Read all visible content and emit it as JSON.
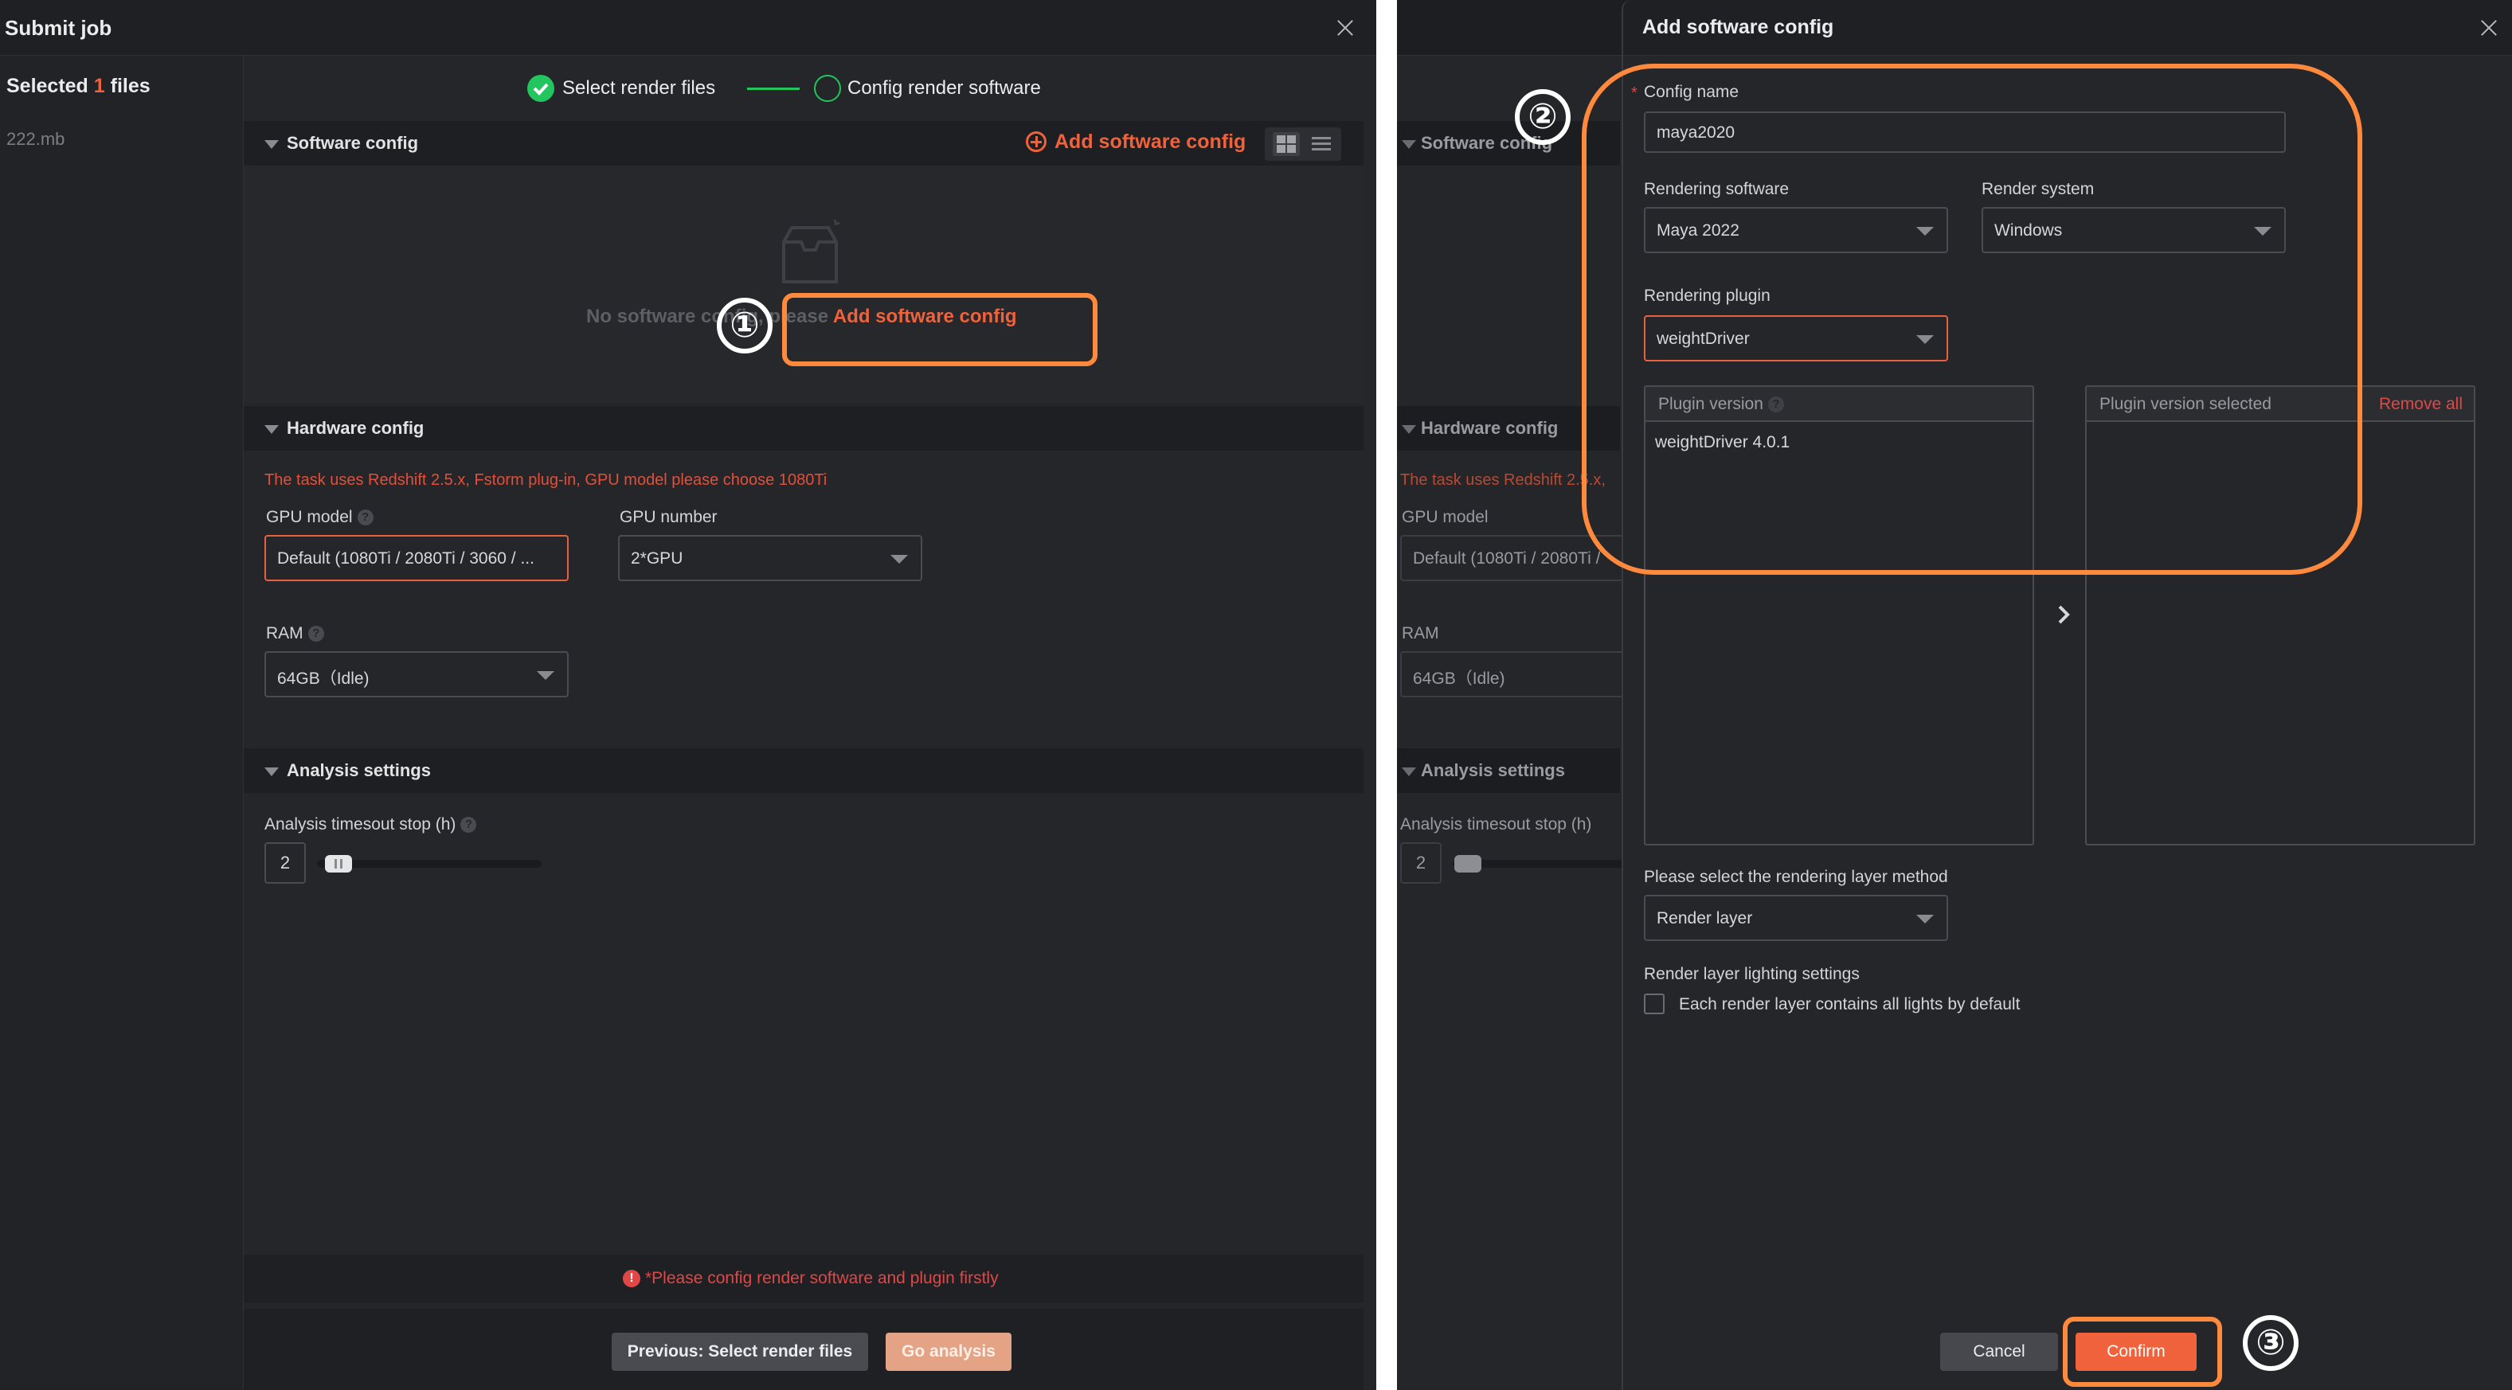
{
  "left": {
    "title": "Submit job",
    "sidebar": {
      "selected_prefix": "Selected",
      "selected_count": "1",
      "selected_suffix": "files",
      "file_name": "222.mb"
    },
    "steps": {
      "step1": "Select render files",
      "step2": "Config render software"
    },
    "software_config": {
      "title": "Software config",
      "add_link": "Add software config",
      "empty_text": "No software config, please",
      "empty_link": "Add software config"
    },
    "hardware_config": {
      "title": "Hardware config",
      "warning": "The task uses Redshift 2.5.x, Fstorm plug-in, GPU model please choose 1080Ti",
      "gpu_model_label": "GPU model",
      "gpu_model_value": "Default (1080Ti / 2080Ti / 3060 / ...",
      "gpu_number_label": "GPU number",
      "gpu_number_value": "2*GPU",
      "ram_label": "RAM",
      "ram_value": "64GB（Idle)"
    },
    "analysis": {
      "title": "Analysis settings",
      "timeout_label": "Analysis timesout stop (h)",
      "timeout_value": "2",
      "slider_fraction": 0.04
    },
    "footer": {
      "error": "*Please config render software and plugin firstly",
      "prev_button": "Previous: Select render files",
      "go_button": "Go analysis"
    }
  },
  "right": {
    "title": "Add software config",
    "config_name_label": "Config name",
    "config_name_value": "maya2020",
    "rendering_software_label": "Rendering software",
    "rendering_software_value": "Maya 2022",
    "render_system_label": "Render system",
    "render_system_value": "Windows",
    "rendering_plugin_label": "Rendering plugin",
    "rendering_plugin_value": "weightDriver",
    "plugin_version_label": "Plugin version",
    "plugin_version_items": [
      "weightDriver 4.0.1"
    ],
    "plugin_version_selected_label": "Plugin version selected",
    "remove_all": "Remove all",
    "layer_method_label": "Please select the rendering layer method",
    "layer_method_value": "Render layer",
    "lighting_label": "Render layer lighting settings",
    "lighting_checkbox": "Each render layer contains all lights by default",
    "cancel_button": "Cancel",
    "confirm_button": "Confirm",
    "bg": {
      "software_config": "Software config",
      "hardware_config": "Hardware config",
      "warning": "The task uses Redshift 2.5.x,",
      "gpu_model_label": "GPU model",
      "gpu_model_value": "Default (1080Ti / 2080Ti /",
      "ram_label": "RAM",
      "ram_value": "64GB（Idle)",
      "analysis": "Analysis settings",
      "timeout_label": "Analysis timesout stop (h)",
      "timeout_value": "2"
    }
  },
  "annotations": {
    "one": "①",
    "two": "②",
    "three": "③"
  },
  "colors": {
    "accent": "#f0623c",
    "success": "#22c55e",
    "highlight": "#ff8a3d",
    "error": "#e04747"
  }
}
